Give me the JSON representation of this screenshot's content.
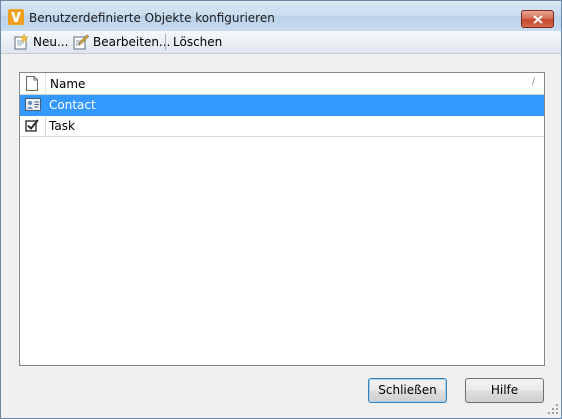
{
  "window": {
    "title": "Benutzerdefinierte Objekte konfigurieren",
    "app_icon": "vault-v-logo-icon",
    "close_icon": "close-icon"
  },
  "toolbar": {
    "new_label": "Neu...",
    "edit_label": "Bearbeiten...",
    "delete_label": "Löschen"
  },
  "list": {
    "columns": [
      "",
      "Name"
    ],
    "sort_indicator": "/",
    "rows": [
      {
        "icon": "contact-card-icon",
        "name": "Contact",
        "selected": true
      },
      {
        "icon": "task-checkbox-icon",
        "name": "Task",
        "selected": false
      }
    ]
  },
  "footer": {
    "close_label": "Schließen",
    "help_label": "Hilfe"
  },
  "colors": {
    "selection": "#3399ff",
    "titlebar": "#c9dcef"
  }
}
